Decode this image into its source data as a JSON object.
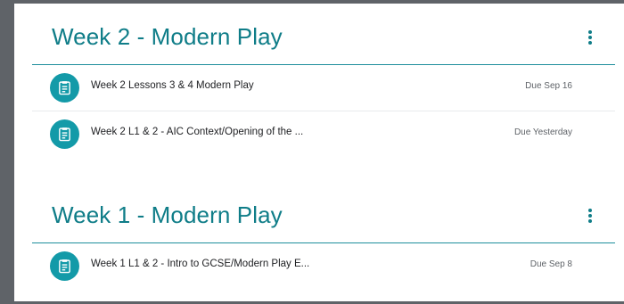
{
  "sections": [
    {
      "title": "Week 2 - Modern Play",
      "items": [
        {
          "icon": "assignment-icon",
          "title": "Week 2 Lessons 3 & 4 Modern Play",
          "due": "Due Sep 16"
        },
        {
          "icon": "assignment-icon",
          "title": "Week 2 L1 & 2 - AIC Context/Opening of the ...",
          "due": "Due Yesterday"
        }
      ]
    },
    {
      "title": "Week 1 - Modern Play",
      "items": [
        {
          "icon": "assignment-icon",
          "title": "Week 1 L1 & 2 - Intro to GCSE/Modern Play E...",
          "due": "Due Sep 8"
        }
      ]
    }
  ],
  "colors": {
    "accent": "#0f7d88",
    "icon_bg": "#139aa8",
    "frame": "#5f6368"
  }
}
